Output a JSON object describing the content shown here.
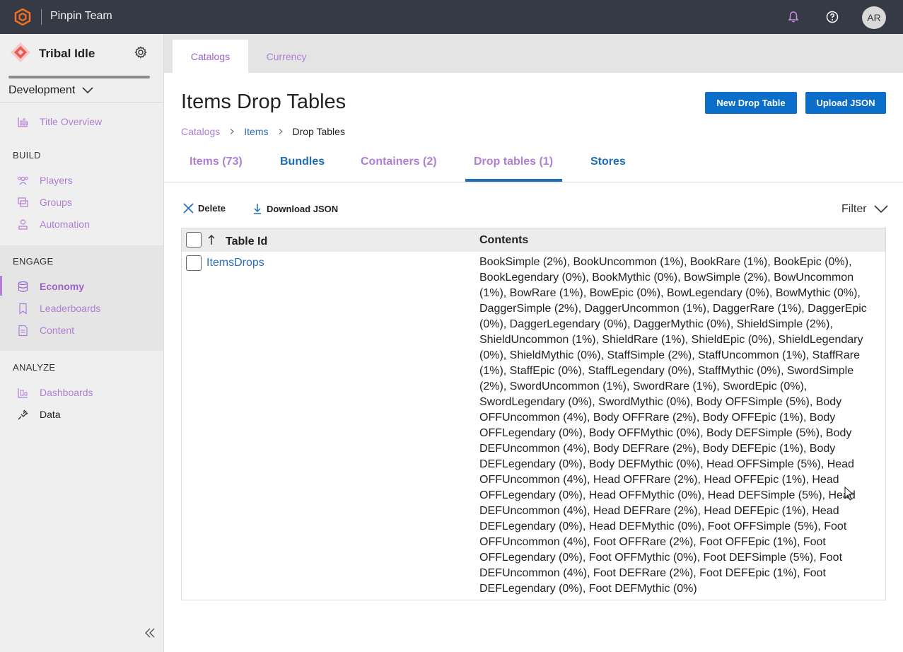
{
  "topbar": {
    "team_name": "Pinpin Team",
    "avatar_initials": "AR"
  },
  "sidebar": {
    "title_name": "Tribal Idle",
    "environment": "Development",
    "top_items": [
      {
        "label": "Title Overview",
        "icon": "bar-chart-icon"
      }
    ],
    "sections": [
      {
        "label": "BUILD",
        "items": [
          {
            "label": "Players",
            "icon": "players-icon"
          },
          {
            "label": "Groups",
            "icon": "groups-icon"
          },
          {
            "label": "Automation",
            "icon": "automation-icon"
          }
        ]
      },
      {
        "label": "ENGAGE",
        "items": [
          {
            "label": "Economy",
            "icon": "database-icon",
            "active": true
          },
          {
            "label": "Leaderboards",
            "icon": "bookmark-icon"
          },
          {
            "label": "Content",
            "icon": "document-icon"
          }
        ]
      },
      {
        "label": "ANALYZE",
        "items": [
          {
            "label": "Dashboards",
            "icon": "dashboard-icon"
          },
          {
            "label": "Data",
            "icon": "plug-icon"
          }
        ]
      }
    ]
  },
  "tabs": [
    {
      "label": "Catalogs",
      "selected": true
    },
    {
      "label": "Currency",
      "selected": false
    }
  ],
  "page": {
    "title": "Items Drop Tables",
    "new_button": "New Drop Table",
    "upload_button": "Upload JSON",
    "breadcrumb": [
      "Catalogs",
      "Items",
      "Drop Tables"
    ]
  },
  "subtabs": [
    {
      "label": "Items (73)"
    },
    {
      "label": "Bundles"
    },
    {
      "label": "Containers (2)"
    },
    {
      "label": "Drop tables (1)",
      "selected": true
    },
    {
      "label": "Stores"
    }
  ],
  "actions": {
    "delete": "Delete",
    "download": "Download JSON",
    "filter": "Filter"
  },
  "table": {
    "columns": [
      "Table Id",
      "Contents"
    ],
    "rows": [
      {
        "id": "ItemsDrops",
        "contents": "BookSimple (2%), BookUncommon (1%), BookRare (1%), BookEpic (0%), BookLegendary (0%), BookMythic (0%), BowSimple (2%), BowUncommon (1%), BowRare (1%), BowEpic (0%), BowLegendary (0%), BowMythic (0%), DaggerSimple (2%), DaggerUncommon (1%), DaggerRare (1%), DaggerEpic (0%), DaggerLegendary (0%), DaggerMythic (0%), ShieldSimple (2%), ShieldUncommon (1%), ShieldRare (1%), ShieldEpic (0%), ShieldLegendary (0%), ShieldMythic (0%), StaffSimple (2%), StaffUncommon (1%), StaffRare (1%), StaffEpic (0%), StaffLegendary (0%), StaffMythic (0%), SwordSimple (2%), SwordUncommon (1%), SwordRare (1%), SwordEpic (0%), SwordLegendary (0%), SwordMythic (0%), Body OFFSimple (5%), Body OFFUncommon (4%), Body OFFRare (2%), Body OFFEpic (1%), Body OFFLegendary (0%), Body OFFMythic (0%), Body DEFSimple (5%), Body DEFUncommon (4%), Body DEFRare (2%), Body DEFEpic (1%), Body DEFLegendary (0%), Body DEFMythic (0%), Head OFFSimple (5%), Head OFFUncommon (4%), Head OFFRare (2%), Head OFFEpic (1%), Head OFFLegendary (0%), Head OFFMythic (0%), Head DEFSimple (5%), Head DEFUncommon (4%), Head DEFRare (2%), Head DEFEpic (1%), Head DEFLegendary (0%), Head DEFMythic (0%), Foot OFFSimple (5%), Foot OFFUncommon (4%), Foot OFFRare (2%), Foot OFFEpic (1%), Foot OFFLegendary (0%), Foot OFFMythic (0%), Foot DEFSimple (5%), Foot DEFUncommon (4%), Foot DEFRare (2%), Foot DEFEpic (1%), Foot DEFLegendary (0%), Foot DEFMythic (0%)"
      }
    ]
  },
  "colors": {
    "accent_purple": "#b07fd4",
    "primary_blue": "#0b6ec8",
    "topbar": "#363a45"
  }
}
